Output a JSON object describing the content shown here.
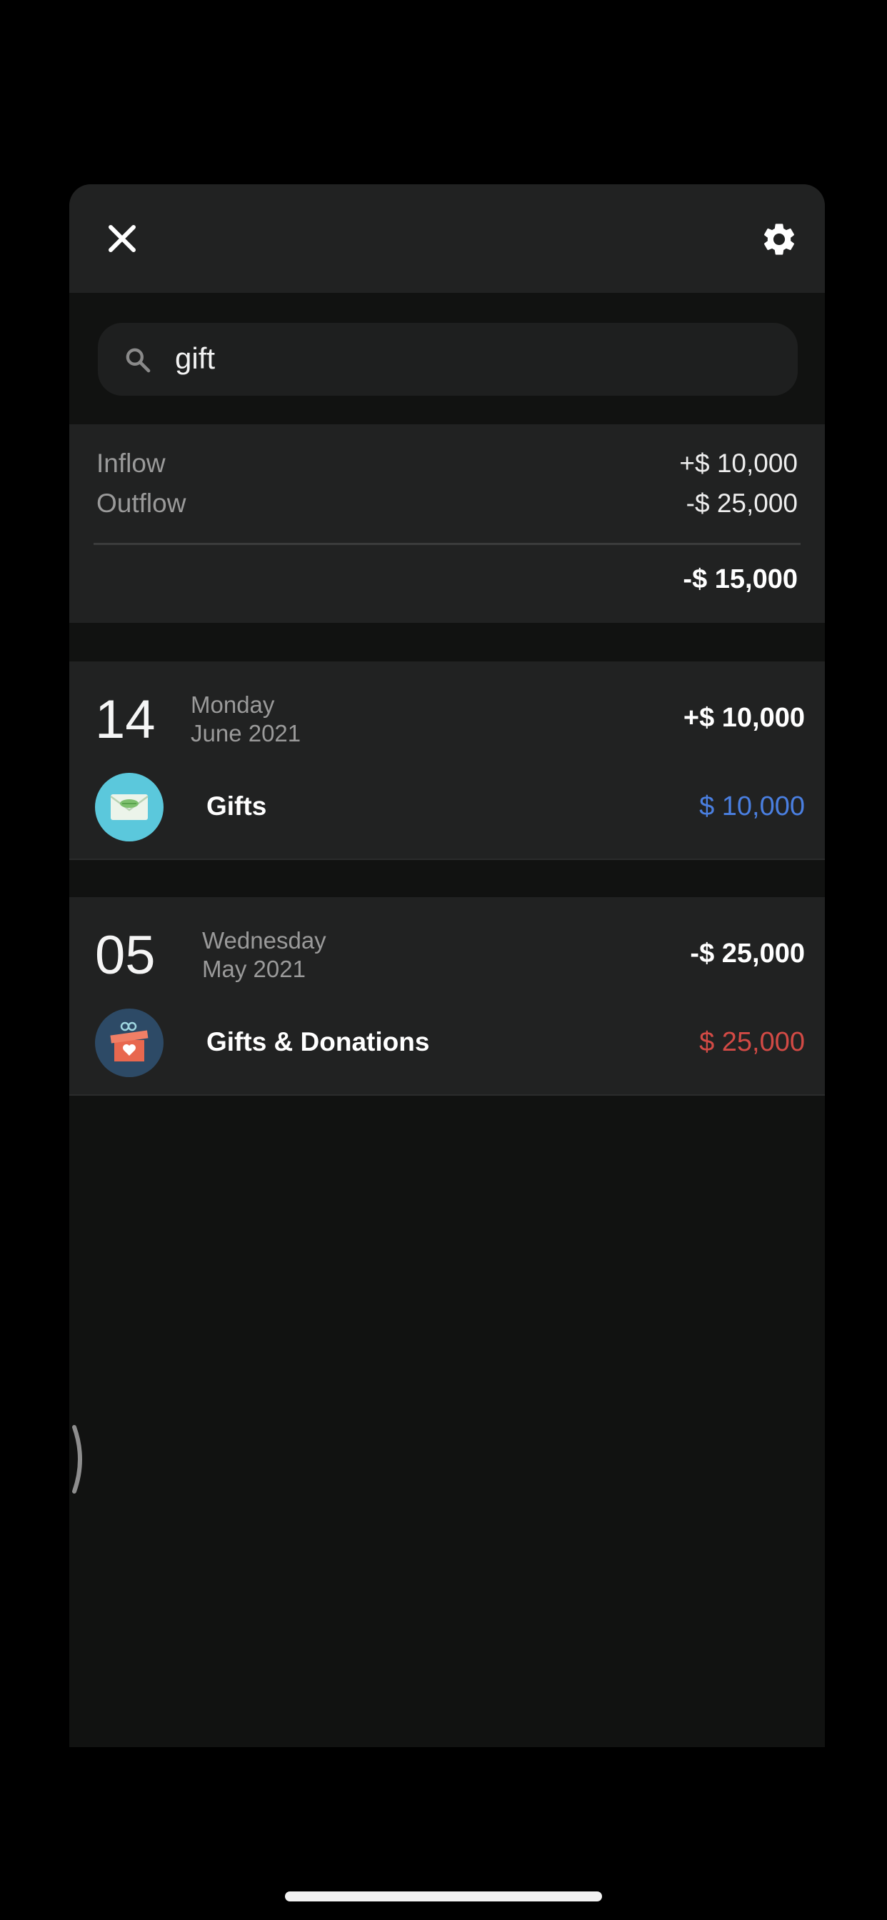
{
  "search": {
    "query": "gift"
  },
  "summary": {
    "inflow_label": "Inflow",
    "inflow_value": "+$ 10,000",
    "outflow_label": "Outflow",
    "outflow_value": "-$ 25,000",
    "total": "-$ 15,000"
  },
  "groups": [
    {
      "day": "14",
      "weekday": "Monday",
      "month_year": "June 2021",
      "total": "+$ 10,000",
      "category": "Gifts",
      "amount": "$ 10,000",
      "amount_color": "#4a7fe0",
      "icon": "gift-envelope-icon"
    },
    {
      "day": "05",
      "weekday": "Wednesday",
      "month_year": "May 2021",
      "total": "-$ 25,000",
      "category": "Gifts & Donations",
      "amount": "$ 25,000",
      "amount_color": "#d24a45",
      "icon": "gift-box-icon"
    }
  ],
  "colors": {
    "background": "#000000",
    "sheet": "#111211",
    "card": "#212222",
    "inflow_accent": "#4a7fe0",
    "outflow_accent": "#d24a45"
  }
}
